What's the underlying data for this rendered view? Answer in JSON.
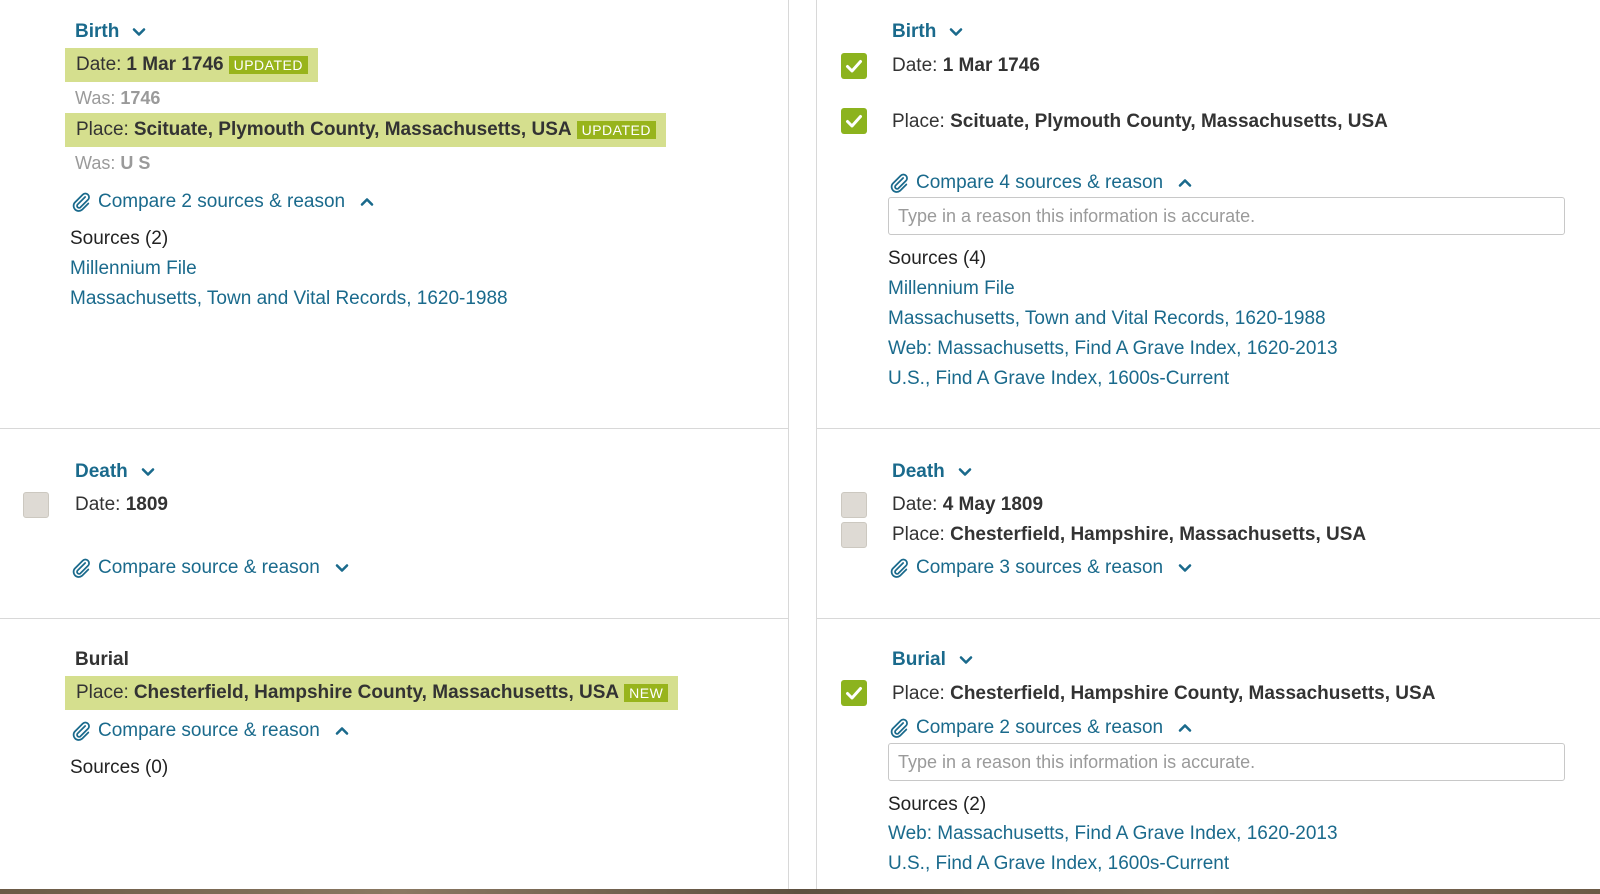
{
  "labels": {
    "date": "Date:",
    "place": "Place:",
    "was": "Was:"
  },
  "left": {
    "birth": {
      "heading": "Birth",
      "date": {
        "value": "1 Mar 1746",
        "badge": "UPDATED",
        "was": "1746"
      },
      "place": {
        "value": "Scituate, Plymouth County, Massachusetts, USA",
        "badge": "UPDATED",
        "was": "U S"
      },
      "compare": "Compare 2 sources & reason",
      "sources_title": "Sources (2)",
      "sources": [
        "Millennium File",
        "Massachusetts, Town and Vital Records, 1620-1988"
      ]
    },
    "death": {
      "heading": "Death",
      "date": {
        "value": "1809",
        "checked": false
      },
      "compare": "Compare source & reason"
    },
    "burial": {
      "heading": "Burial",
      "place": {
        "value": "Chesterfield, Hampshire County, Massachusetts, USA",
        "badge": "NEW"
      },
      "compare": "Compare source & reason",
      "sources_title": "Sources (0)"
    }
  },
  "right": {
    "birth": {
      "heading": "Birth",
      "date": {
        "value": "1 Mar 1746",
        "checked": true
      },
      "place": {
        "value": "Scituate, Plymouth County, Massachusetts, USA",
        "checked": true
      },
      "compare": "Compare 4 sources & reason",
      "reason_placeholder": "Type in a reason this information is accurate.",
      "sources_title": "Sources (4)",
      "sources": [
        "Millennium File",
        "Massachusetts, Town and Vital Records, 1620-1988",
        "Web: Massachusetts, Find A Grave Index, 1620-2013",
        "U.S., Find A Grave Index, 1600s-Current"
      ]
    },
    "death": {
      "heading": "Death",
      "date": {
        "value": "4 May 1809",
        "checked": false
      },
      "place": {
        "value": "Chesterfield, Hampshire, Massachusetts, USA",
        "checked": false
      },
      "compare": "Compare 3 sources & reason"
    },
    "burial": {
      "heading": "Burial",
      "place": {
        "value": "Chesterfield, Hampshire County, Massachusetts, USA",
        "checked": true
      },
      "compare": "Compare 2 sources & reason",
      "reason_placeholder": "Type in a reason this information is accurate.",
      "sources_title": "Sources (2)",
      "sources": [
        "Web: Massachusetts, Find A Grave Index, 1620-2013",
        "U.S., Find A Grave Index, 1600s-Current"
      ]
    }
  },
  "colors": {
    "link": "#1a6a8c",
    "highlight": "#d5df8e",
    "badge": "#98b41c",
    "checkbox_checked": "#8cb31e",
    "checkbox_unchecked": "#dedad4"
  },
  "icons": {
    "expand": "chevron-down-icon",
    "collapse": "chevron-up-icon",
    "attach": "paperclip-icon",
    "check": "checkmark-icon"
  }
}
